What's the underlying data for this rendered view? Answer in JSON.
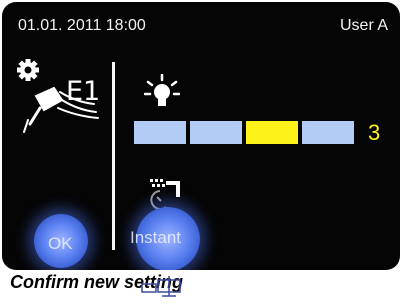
{
  "status": {
    "datetime": "01.01. 2011 18:00",
    "user": "User A"
  },
  "tool": {
    "label": "E1",
    "icon": "gear-handpiece-icon"
  },
  "light": {
    "icon": "lightbulb-icon",
    "level": "3",
    "levels_total": 4,
    "active_level": 3,
    "colors": {
      "inactive": "#b3ccf5",
      "active": "#fff21a"
    }
  },
  "shower": {
    "icon": "spray-timer-icon"
  },
  "buttons": {
    "ok": "OK",
    "instant": "Instant"
  },
  "hint": "Confirm new setting"
}
